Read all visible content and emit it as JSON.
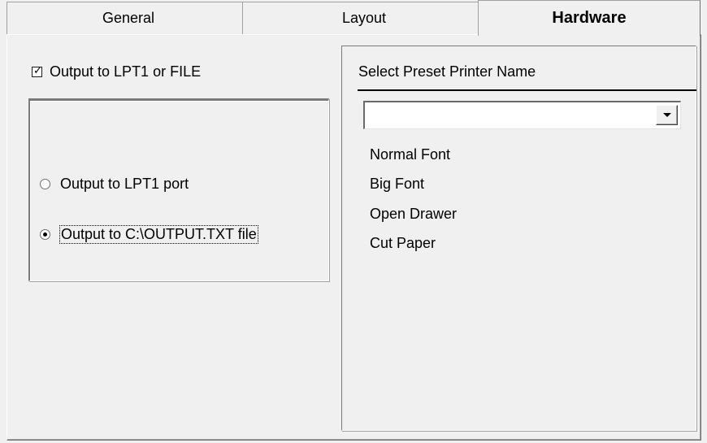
{
  "tabs": {
    "general": "General",
    "layout": "Layout",
    "hardware": "Hardware",
    "active": "hardware"
  },
  "output_checkbox": {
    "label": "Output to LPT1 or FILE",
    "checked": true
  },
  "output_target": {
    "options": [
      {
        "label": "Output to LPT1 port",
        "selected": false
      },
      {
        "label": "Output to C:\\OUTPUT.TXT file",
        "selected": true
      }
    ]
  },
  "preset": {
    "label": "Select Preset Printer Name",
    "selected_value": "",
    "commands": [
      "Normal Font",
      "Big Font",
      "Open Drawer",
      "Cut Paper"
    ]
  }
}
